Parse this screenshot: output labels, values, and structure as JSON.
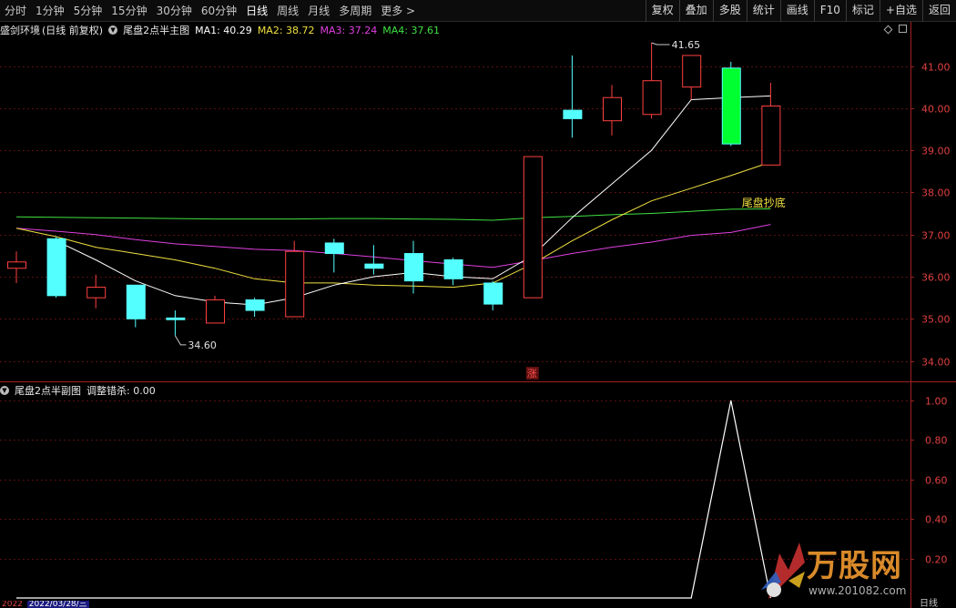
{
  "toolbar": {
    "period_tabs": [
      "分时",
      "1分钟",
      "5分钟",
      "15分钟",
      "30分钟",
      "60分钟",
      "日线",
      "周线",
      "月线",
      "多周期",
      "更多 >"
    ],
    "active_tab": "日线",
    "buttons": [
      "复权",
      "叠加",
      "多股",
      "统计",
      "画线",
      "F10",
      "标记",
      "+自选",
      "返回"
    ]
  },
  "main_panel": {
    "stock_name": "盛剑环境",
    "mode": "(日线 前复权)",
    "indicator": "尾盘2点半主图",
    "ma": [
      {
        "label": "MA1: 40.29",
        "color": "#ffffff"
      },
      {
        "label": "MA2: 38.72",
        "color": "#f0e040"
      },
      {
        "label": "MA3: 37.24",
        "color": "#e040e0"
      },
      {
        "label": "MA4: 37.61",
        "color": "#40e040"
      }
    ],
    "high_label": "41.65",
    "low_label": "34.60",
    "annotation": "尾盘抄底",
    "zhang_label": "涨"
  },
  "sub_panel": {
    "indicator": "尾盘2点半副图",
    "value_label": "调整错杀: 0.00"
  },
  "chart_data": [
    {
      "type": "candlestick",
      "title": "尾盘2点半主图",
      "ylim": [
        33.6,
        42.3
      ],
      "yticks": [
        "41.00",
        "40.00",
        "39.00",
        "38.00",
        "37.00",
        "36.00",
        "35.00",
        "34.00"
      ],
      "ytick_values": [
        41,
        40,
        39,
        38,
        37,
        36,
        35,
        34
      ],
      "candles": [
        {
          "open": 36.2,
          "close": 36.35,
          "high": 36.6,
          "low": 35.85
        },
        {
          "open": 36.9,
          "close": 35.55,
          "high": 36.95,
          "low": 35.5
        },
        {
          "open": 35.5,
          "close": 35.75,
          "high": 36.05,
          "low": 35.25
        },
        {
          "open": 35.8,
          "close": 35.0,
          "high": 35.8,
          "low": 34.8
        },
        {
          "open": 35.02,
          "close": 34.98,
          "high": 35.2,
          "low": 34.6
        },
        {
          "open": 34.9,
          "close": 35.45,
          "high": 35.55,
          "low": 34.9
        },
        {
          "open": 35.45,
          "close": 35.2,
          "high": 35.5,
          "low": 35.05
        },
        {
          "open": 35.05,
          "close": 36.6,
          "high": 36.85,
          "low": 35.05
        },
        {
          "open": 36.8,
          "close": 36.55,
          "high": 36.9,
          "low": 36.1
        },
        {
          "open": 36.3,
          "close": 36.2,
          "high": 36.75,
          "low": 36.05
        },
        {
          "open": 36.55,
          "close": 35.9,
          "high": 36.85,
          "low": 35.6
        },
        {
          "open": 36.4,
          "close": 35.95,
          "high": 36.45,
          "low": 35.8
        },
        {
          "open": 35.85,
          "close": 35.35,
          "high": 35.9,
          "low": 35.2
        },
        {
          "open": 35.5,
          "close": 38.85,
          "high": 38.85,
          "low": 35.5
        },
        {
          "open": 39.95,
          "close": 39.75,
          "high": 41.25,
          "low": 39.3
        },
        {
          "open": 39.7,
          "close": 40.25,
          "high": 40.55,
          "low": 39.35
        },
        {
          "open": 39.85,
          "close": 40.65,
          "high": 41.55,
          "low": 39.75
        },
        {
          "open": 40.5,
          "close": 41.25,
          "high": 41.25,
          "low": 40.2
        },
        {
          "open": 40.95,
          "close": 39.15,
          "high": 41.1,
          "low": 39.1
        },
        {
          "open": 38.65,
          "close": 40.05,
          "high": 40.6,
          "low": 38.65
        }
      ],
      "series": [
        {
          "name": "MA1",
          "color": "#ffffff",
          "values": [
            null,
            36.85,
            36.4,
            35.9,
            35.55,
            35.4,
            35.33,
            35.5,
            35.8,
            36.0,
            36.1,
            36.0,
            35.95,
            36.5,
            37.4,
            38.2,
            39.0,
            40.2,
            40.25,
            40.29
          ]
        },
        {
          "name": "MA2",
          "color": "#f0e040",
          "values": [
            37.15,
            36.95,
            36.7,
            36.55,
            36.4,
            36.2,
            35.95,
            35.85,
            35.85,
            35.8,
            35.78,
            35.75,
            35.85,
            36.3,
            36.85,
            37.35,
            37.8,
            38.1,
            38.4,
            38.72
          ]
        },
        {
          "name": "MA3",
          "color": "#e040e0",
          "values": [
            37.15,
            37.08,
            37.0,
            36.88,
            36.78,
            36.72,
            36.65,
            36.62,
            36.55,
            36.47,
            36.38,
            36.3,
            36.22,
            36.38,
            36.55,
            36.7,
            36.82,
            36.98,
            37.05,
            37.24
          ]
        },
        {
          "name": "MA4",
          "color": "#40e040",
          "values": [
            37.42,
            37.41,
            37.4,
            37.39,
            37.38,
            37.37,
            37.37,
            37.37,
            37.38,
            37.38,
            37.37,
            37.36,
            37.34,
            37.4,
            37.43,
            37.47,
            37.5,
            37.55,
            37.6,
            37.61
          ]
        }
      ]
    },
    {
      "type": "line",
      "title": "尾盘2点半副图",
      "ylim": [
        0,
        1.1
      ],
      "yticks": [
        "1.00",
        "0.80",
        "0.60",
        "0.40",
        "0.20"
      ],
      "ytick_values": [
        1.0,
        0.8,
        0.6,
        0.4,
        0.2
      ],
      "series": [
        {
          "name": "调整错杀",
          "color": "#ffffff",
          "values": [
            0,
            0,
            0,
            0,
            0,
            0,
            0,
            0,
            0,
            0,
            0,
            0,
            0,
            0,
            0,
            0,
            0,
            0,
            1.0,
            0
          ]
        }
      ]
    }
  ],
  "date_bar": [
    "2022",
    "2022/03/28/三"
  ],
  "watermark": {
    "brand": "万股网",
    "url": "www.201082.com"
  },
  "bottom_right": "日线"
}
